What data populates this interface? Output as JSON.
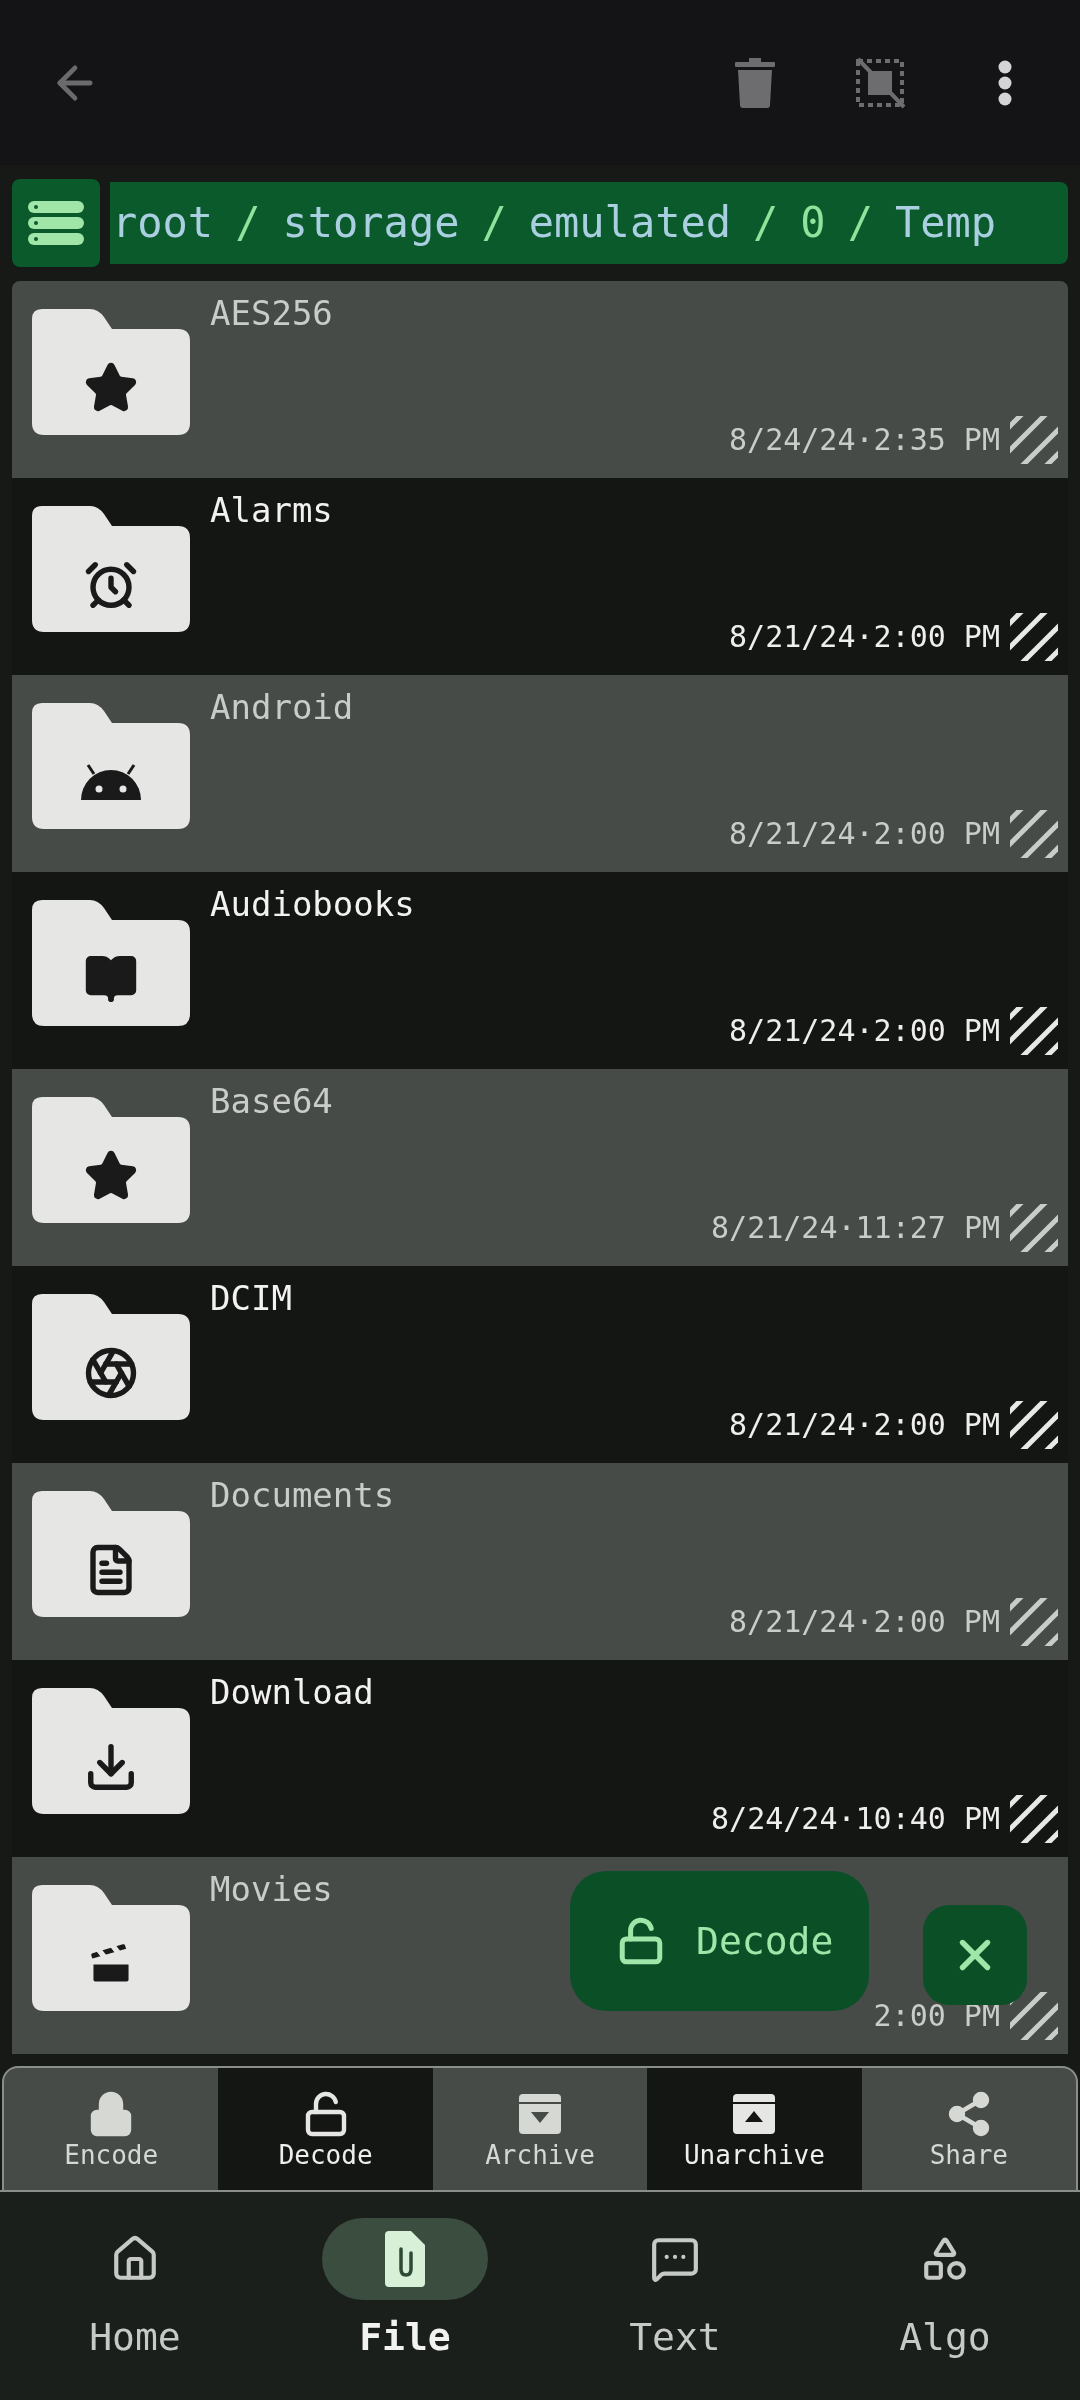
{
  "breadcrumb": [
    {
      "label": "root",
      "color": "#a9cfe0"
    },
    {
      "label": "/",
      "color": "#8fe39a"
    },
    {
      "label": "storage",
      "color": "#a9cfe0"
    },
    {
      "label": "/",
      "color": "#8fe39a"
    },
    {
      "label": "emulated",
      "color": "#a9cfe0"
    },
    {
      "label": "/",
      "color": "#8fe39a"
    },
    {
      "label": "0",
      "color": "#8fe39a"
    },
    {
      "label": "/",
      "color": "#8fe39a"
    },
    {
      "label": "Temp",
      "color": "#a9cfe0"
    }
  ],
  "files": [
    {
      "name": "AES256",
      "modified": "8/24/24·2:35 PM",
      "kind": "star"
    },
    {
      "name": "Alarms",
      "modified": "8/21/24·2:00 PM",
      "kind": "alarm"
    },
    {
      "name": "Android",
      "modified": "8/21/24·2:00 PM",
      "kind": "android"
    },
    {
      "name": "Audiobooks",
      "modified": "8/21/24·2:00 PM",
      "kind": "book"
    },
    {
      "name": "Base64",
      "modified": "8/21/24·11:27 PM",
      "kind": "star"
    },
    {
      "name": "DCIM",
      "modified": "8/21/24·2:00 PM",
      "kind": "camera"
    },
    {
      "name": "Documents",
      "modified": "8/21/24·2:00 PM",
      "kind": "document"
    },
    {
      "name": "Download",
      "modified": "8/24/24·10:40 PM",
      "kind": "download"
    },
    {
      "name": "Movies",
      "modified": "2:00 PM",
      "kind": "movie"
    }
  ],
  "fab": {
    "label": "Decode"
  },
  "actions": [
    {
      "label": "Encode",
      "kind": "lock"
    },
    {
      "label": "Decode",
      "kind": "unlock"
    },
    {
      "label": "Archive",
      "kind": "archive"
    },
    {
      "label": "Unarchive",
      "kind": "unarchive"
    },
    {
      "label": "Share",
      "kind": "share"
    }
  ],
  "nav": [
    {
      "label": "Home",
      "kind": "home",
      "selected": false
    },
    {
      "label": "File",
      "kind": "file",
      "selected": true
    },
    {
      "label": "Text",
      "kind": "text",
      "selected": false
    },
    {
      "label": "Algo",
      "kind": "algo",
      "selected": false
    }
  ]
}
